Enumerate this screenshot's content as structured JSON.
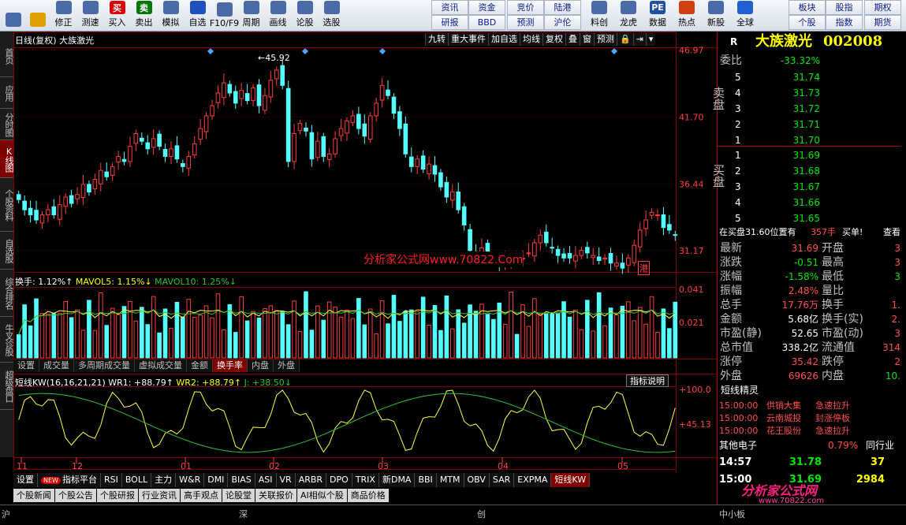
{
  "colors": {
    "up": "#ff3c3c",
    "down": "#54ffff",
    "wr1": "#ffff40",
    "wr2": "#30c030",
    "grid": "#7a0000"
  },
  "toolbar": {
    "buttons": [
      {
        "label": "",
        "icon": "grid-icon"
      },
      {
        "label": "",
        "icon": "back-arrow-icon"
      },
      {
        "label": "修正",
        "icon": "fix-icon"
      },
      {
        "label": "测速",
        "icon": "speed-icon"
      },
      {
        "label": "买入",
        "icon": "buy-icon",
        "glyph": "买"
      },
      {
        "label": "卖出",
        "icon": "sell-icon",
        "glyph": "卖"
      },
      {
        "label": "模拟",
        "icon": "simulate-icon"
      },
      {
        "label": "自选",
        "icon": "star-icon"
      },
      {
        "label": "F10/F9",
        "icon": "f10-icon"
      },
      {
        "label": "周期",
        "icon": "period-icon"
      },
      {
        "label": "画线",
        "icon": "draw-line-icon"
      },
      {
        "label": "论股",
        "icon": "discuss-icon"
      },
      {
        "label": "选股",
        "icon": "stock-pick-icon"
      }
    ],
    "grid1": [
      "资讯",
      "资金",
      "研报",
      "BBD"
    ],
    "grid2": [
      "竞价",
      "陆港",
      "预测",
      "沪伦"
    ],
    "buttons2": [
      {
        "label": "料创",
        "icon": "paper-icon"
      },
      {
        "label": "龙虎",
        "icon": "dragon-icon"
      },
      {
        "label": "数据",
        "icon": "pe-icon",
        "glyph": "PE"
      },
      {
        "label": "热点",
        "icon": "hot-icon"
      },
      {
        "label": "新股",
        "icon": "new-stock-icon"
      },
      {
        "label": "全球",
        "icon": "globe-icon"
      }
    ],
    "grid3": [
      "板块",
      "股指",
      "个股",
      "指数"
    ],
    "grid4": [
      "期权",
      "期货"
    ]
  },
  "lefttabs": [
    "首页",
    "应用",
    "分时图",
    "K线图",
    "个股资料",
    "自选股",
    "综合排名",
    "牛叉诊股",
    "超级盘口"
  ],
  "main": {
    "title": "日线(复权) 大族激光",
    "topbtns": [
      "九转",
      "重大事件",
      "加自选",
      "均线",
      "复权",
      "叠",
      "窗",
      "预测"
    ],
    "price_axis": [
      "46.97",
      "41.70",
      "36.44",
      "31.17"
    ],
    "high_label": "45.92",
    "watermark": "分析家公式网www.70822.Com",
    "hk_badge": "港",
    "vol_header": {
      "a": "换手: 1.12%↑",
      "b": "MAVOL5: 1.15%↓",
      "c": "MAVOL10: 1.25%↓"
    },
    "vol_axis": [
      "0.041",
      "0.021"
    ],
    "subtabs": [
      "设置",
      "成交量",
      "多周期成交量",
      "虚拟成交量",
      "金额",
      "换手率",
      "内盘",
      "外盘"
    ],
    "kw_header": {
      "a": "短线KW(16,16,21,21)",
      "b": "WR1: +88.79↑",
      "c": "WR2: +88.79↑",
      "d": "J: +38.50↓"
    },
    "kw_button": "指标说明",
    "kw_axis": [
      "+100.0",
      "+45.13"
    ],
    "months": [
      "11",
      "12",
      "01",
      "02",
      "03",
      "04",
      "05"
    ],
    "indtabs": [
      "设置",
      "指标平台",
      "RSI",
      "BOLL",
      "主力",
      "W&R",
      "DMI",
      "BIAS",
      "ASI",
      "VR",
      "ARBR",
      "DPO",
      "TRIX",
      "新DMA",
      "BBI",
      "MTM",
      "OBV",
      "SAR",
      "EXPMA",
      "短线KW"
    ],
    "new_badge": "NEW"
  },
  "bottomtabs": [
    "个股新闻",
    "个股公告",
    "个股研报",
    "行业资讯",
    "高手观点",
    "论股堂",
    "关联报价",
    "AI相似个股",
    "商品价格"
  ],
  "status": {
    "a": "沪",
    "b": "深",
    "c": "创",
    "d": "中小板"
  },
  "right": {
    "code_prefix": "R",
    "name": "大族激光",
    "code": "002008",
    "weibi_label": "委比",
    "weibi": "-33.32%",
    "sell_label": "卖盘",
    "buy_label": "买盘",
    "sell": [
      [
        "5",
        "31.74"
      ],
      [
        "4",
        "31.73"
      ],
      [
        "3",
        "31.72"
      ],
      [
        "2",
        "31.71"
      ],
      [
        "1",
        "31.70"
      ]
    ],
    "buy": [
      [
        "1",
        "31.69"
      ],
      [
        "2",
        "31.68"
      ],
      [
        "3",
        "31.67"
      ],
      [
        "4",
        "31.66"
      ],
      [
        "5",
        "31.65"
      ]
    ],
    "buyline": {
      "a": "在买盘31.60位置有",
      "b": "357手",
      "c": "买单!",
      "d": "查看"
    },
    "stats": [
      [
        "最新",
        "31.69",
        "开盘",
        "3"
      ],
      [
        "涨跌",
        "-0.51",
        "最高",
        "3"
      ],
      [
        "涨幅",
        "-1.58%",
        "最低",
        "3"
      ],
      [
        "振幅",
        "2.48%",
        "量比",
        ""
      ],
      [
        "总手",
        "17.76万",
        "换手",
        "1."
      ],
      [
        "金额",
        "5.68亿",
        "换手(实)",
        "2."
      ],
      [
        "市盈(静)",
        "52.65",
        "市盈(动)",
        "3"
      ],
      [
        "总市值",
        "338.2亿",
        "流通值",
        "314"
      ],
      [
        "涨停",
        "35.42",
        "跌停",
        "2"
      ],
      [
        "外盘",
        "69626",
        "内盘",
        "10."
      ]
    ],
    "jl_title": "短线精灵",
    "jl": [
      [
        "15:00:00",
        "供销大集",
        "急速拉升"
      ],
      [
        "15:00:00",
        "云南城投",
        "封涨停板"
      ],
      [
        "15:00:00",
        "花王股份",
        "急速拉升"
      ]
    ],
    "sector_name": "其他电子",
    "sector_pct": "0.79%",
    "sector_link": "同行业",
    "ticks": [
      [
        "14:57",
        "31.78",
        "37"
      ],
      [
        "15:00",
        "31.69",
        "2984"
      ]
    ],
    "logo": "分析家公式网",
    "logo_url": "www.70822.com"
  },
  "chart_data": {
    "type": "candlestick",
    "title": "日线(复权) 大族激光",
    "ylim": [
      29.5,
      47.2
    ],
    "price_ticks": [
      46.97,
      41.7,
      36.44,
      31.17
    ],
    "x_ticks": [
      "11",
      "12",
      "01",
      "02",
      "03",
      "04",
      "05"
    ],
    "closes": [
      35.2,
      34.4,
      34.0,
      33.6,
      34.0,
      34.4,
      34.0,
      34.8,
      35.4,
      34.9,
      35.6,
      36.4,
      35.8,
      36.8,
      37.5,
      37.0,
      37.8,
      38.6,
      38.2,
      39.4,
      40.4,
      39.8,
      39.2,
      40.0,
      39.4,
      38.6,
      39.2,
      38.4,
      37.8,
      38.6,
      39.6,
      40.8,
      41.8,
      42.6,
      43.6,
      44.4,
      43.6,
      42.8,
      43.8,
      43.0,
      44.0,
      42.6,
      43.4,
      44.6,
      45.4,
      44.2,
      38.2,
      40.4,
      41.2,
      40.6,
      38.4,
      39.8,
      38.6,
      38.8,
      40.0,
      40.8,
      41.4,
      41.8,
      40.8,
      40.2,
      41.8,
      42.8,
      44.2,
      43.4,
      42.0,
      40.8,
      38.8,
      37.8,
      38.4,
      37.6,
      38.0,
      37.2,
      36.2,
      35.4,
      35.8,
      34.4,
      33.2,
      31.2,
      30.8,
      31.4,
      30.6,
      30.2,
      30.0,
      30.4,
      30.8,
      30.4,
      30.6,
      31.0,
      31.8,
      32.4,
      31.8,
      31.4,
      30.8,
      30.6,
      30.6,
      30.8,
      31.2,
      31.0,
      30.8,
      30.4,
      30.6,
      30.2,
      30.2,
      29.8,
      30.6,
      31.6,
      32.8,
      33.6,
      34.2,
      34.0,
      33.0,
      32.8,
      32.4
    ]
  }
}
